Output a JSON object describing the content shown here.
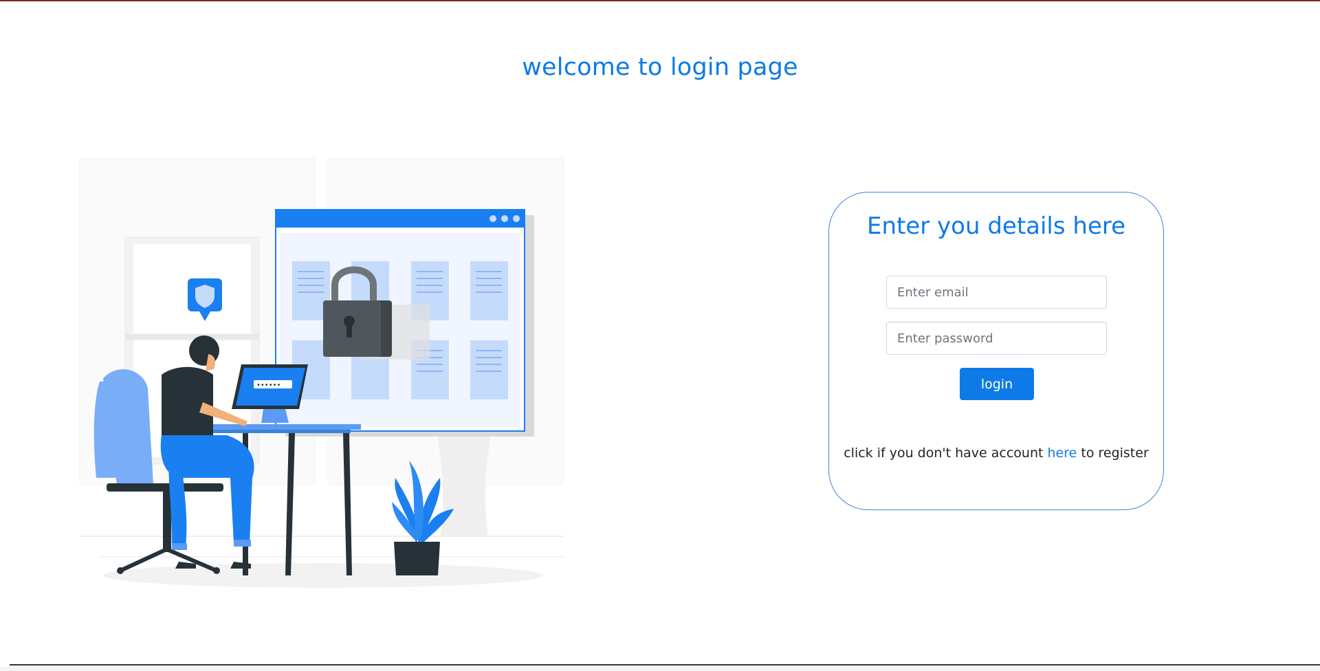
{
  "page": {
    "title": "welcome to login page"
  },
  "login_card": {
    "title": "Enter you details here",
    "email": {
      "value": "",
      "placeholder": "Enter email"
    },
    "password": {
      "value": "",
      "placeholder": "Enter password"
    },
    "login_button_label": "login",
    "register": {
      "prefix": "click if you don't have account ",
      "link_label": "here",
      "suffix": " to register"
    }
  },
  "illustration": {
    "description_icon": "person-at-laptop-with-padlock-icon",
    "password_mask": "••••••"
  },
  "colors": {
    "accent": "#0d7ae8",
    "card_border": "#3a84d6",
    "dark": "#263238",
    "light_blue": "#c5dbfc"
  }
}
